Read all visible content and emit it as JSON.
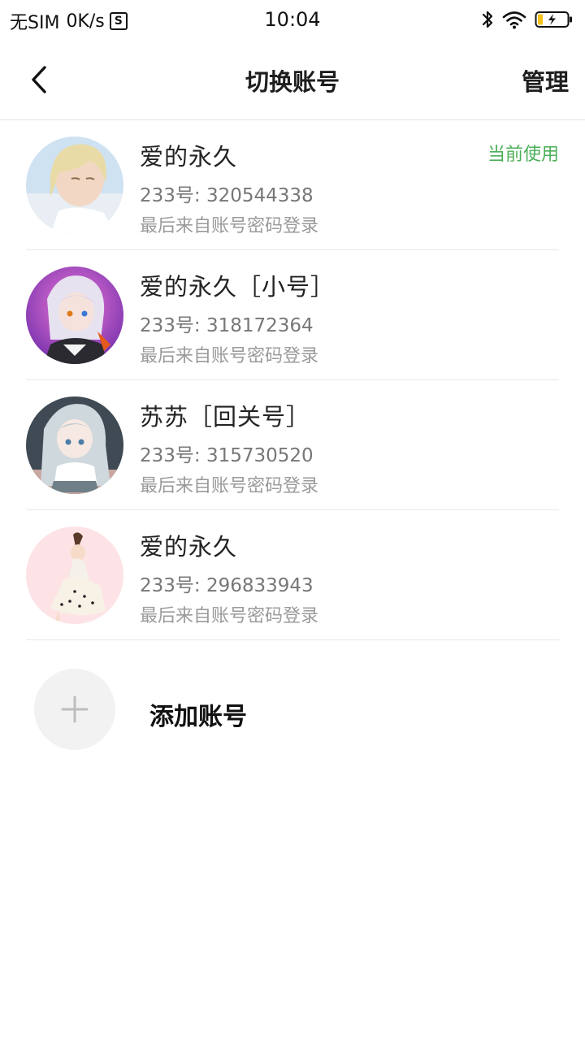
{
  "status_bar": {
    "carrier": "无SIM",
    "speed": "0K/s",
    "s_badge": "S",
    "time": "10:04"
  },
  "header": {
    "title": "切换账号",
    "manage_label": "管理"
  },
  "accounts": [
    {
      "name": "爱的永久",
      "id_text": "233号: 320544338",
      "login_text": "最后来自账号密码登录",
      "current_label": "当前使用"
    },
    {
      "name": "爱的永久［小号］",
      "id_text": "233号: 318172364",
      "login_text": "最后来自账号密码登录"
    },
    {
      "name": "苏苏［回关号］",
      "id_text": "233号: 315730520",
      "login_text": "最后来自账号密码登录"
    },
    {
      "name": "爱的永久",
      "id_text": "233号: 296833943",
      "login_text": "最后来自账号密码登录"
    }
  ],
  "add_account": {
    "label": "添加账号"
  },
  "colors": {
    "accent_green": "#4caf5a",
    "divider": "#e8e8e8"
  },
  "icons": [
    "back-arrow-icon",
    "bluetooth-icon",
    "wifi-icon",
    "battery-charging-icon",
    "plus-icon"
  ]
}
